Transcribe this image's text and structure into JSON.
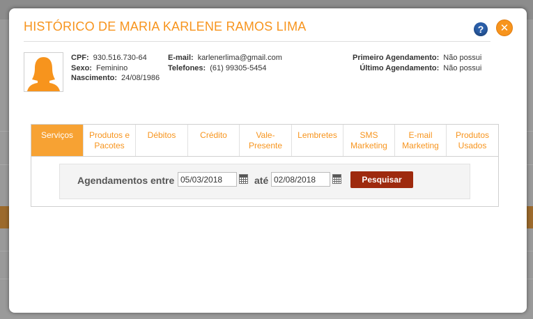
{
  "modal": {
    "title": "HISTÓRICO DE MARIA KARLENE RAMOS LIMA",
    "help_label": "?",
    "close_label": "✕"
  },
  "client": {
    "cpf_label": "CPF:",
    "cpf": "930.516.730-64",
    "sexo_label": "Sexo:",
    "sexo": "Feminino",
    "nascimento_label": "Nascimento:",
    "nascimento": "24/08/1986",
    "email_label": "E-mail:",
    "email": "karlenerlima@gmail.com",
    "telefones_label": "Telefones:",
    "telefones": "(61) 99305-5454",
    "primeiro_label": "Primeiro Agendamento:",
    "primeiro": "Não possui",
    "ultimo_label": "Último Agendamento:",
    "ultimo": "Não possui"
  },
  "tabs": [
    {
      "label": "Serviços",
      "active": true
    },
    {
      "label": "Produtos e Pacotes"
    },
    {
      "label": "Débitos"
    },
    {
      "label": "Crédito"
    },
    {
      "label": "Vale-Presente"
    },
    {
      "label": "Lembretes"
    },
    {
      "label": "SMS Marketing"
    },
    {
      "label": "E-mail Marketing"
    },
    {
      "label": "Produtos Usados"
    }
  ],
  "search": {
    "label": "Agendamentos entre",
    "start_date": "05/03/2018",
    "between_label": "até",
    "end_date": "02/08/2018",
    "button_label": "Pesquisar"
  },
  "colors": {
    "accent": "#f7941d",
    "active_tab": "#f7a233",
    "button": "#9e2a0e",
    "help": "#2a5ea8"
  }
}
